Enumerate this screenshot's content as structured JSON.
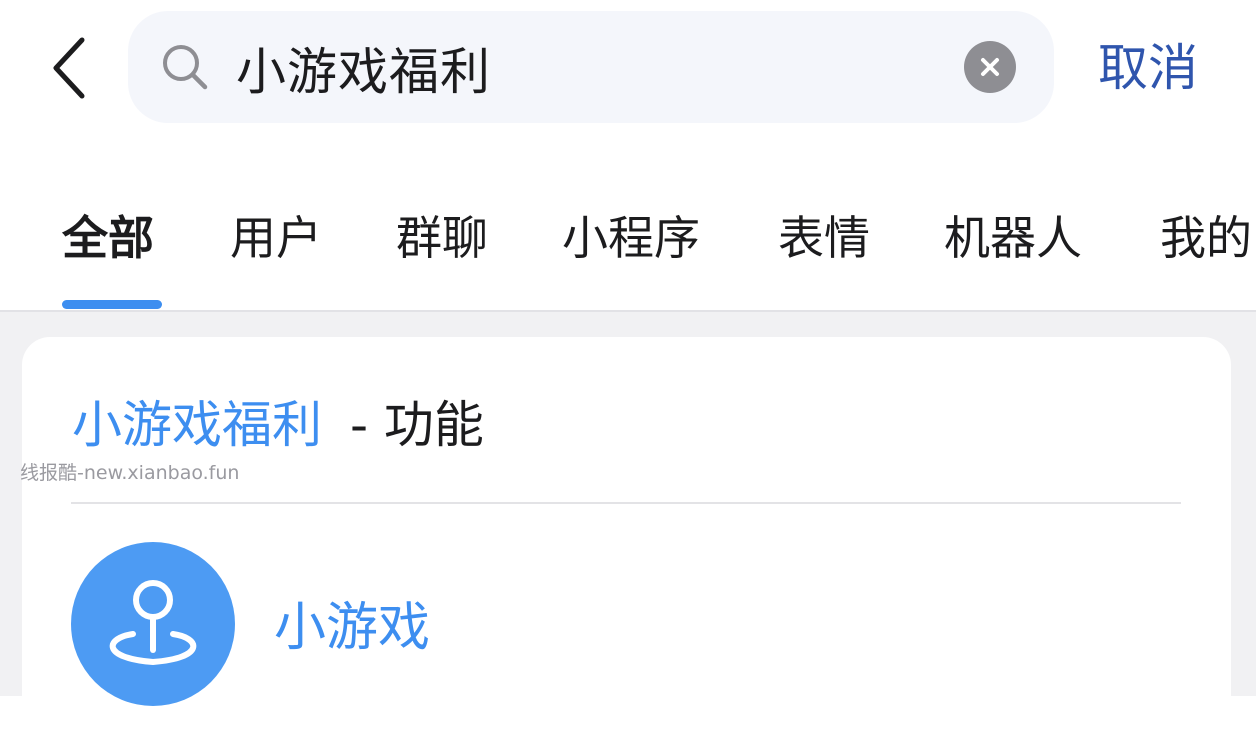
{
  "search": {
    "query": "小游戏福利",
    "cancel_label": "取消",
    "icon": "search-icon"
  },
  "tabs": [
    {
      "label": "全部",
      "active": true
    },
    {
      "label": "用户",
      "active": false
    },
    {
      "label": "群聊",
      "active": false
    },
    {
      "label": "小程序",
      "active": false
    },
    {
      "label": "表情",
      "active": false
    },
    {
      "label": "机器人",
      "active": false
    },
    {
      "label": "我的",
      "active": false
    }
  ],
  "result_card": {
    "keyword": "小游戏福利",
    "type_label": "- 功能",
    "watermark": "线报酷-new.xianbao.fun",
    "items": [
      {
        "title": "小游戏",
        "icon": "joystick-icon"
      }
    ]
  },
  "colors": {
    "accent": "#3d8ef0",
    "cancel": "#2f55ad",
    "avatar": "#4d9bf3",
    "background": "#f1f1f3"
  }
}
